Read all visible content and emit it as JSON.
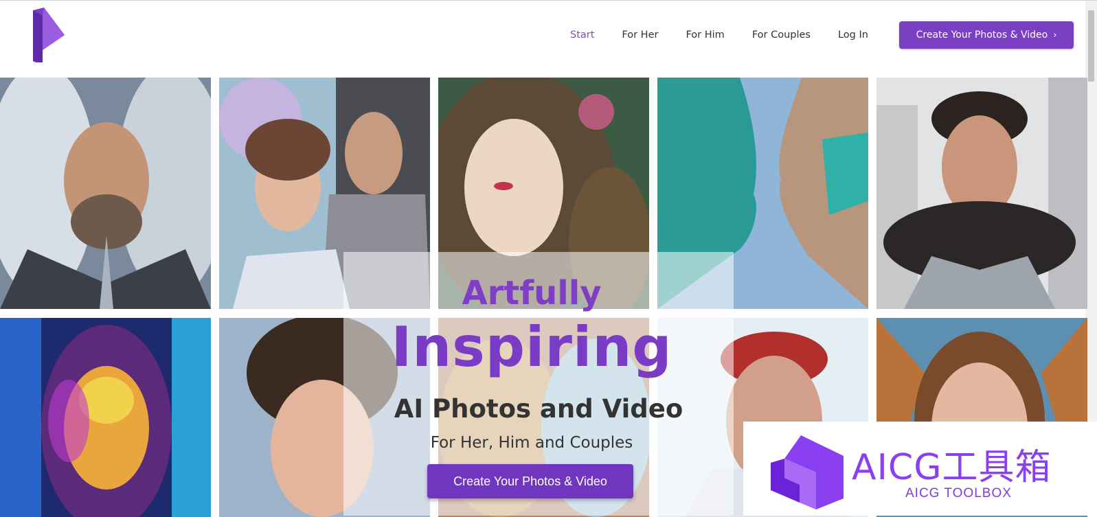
{
  "nav": {
    "items": [
      {
        "label": "Start",
        "active": true
      },
      {
        "label": "For Her",
        "active": false
      },
      {
        "label": "For Him",
        "active": false
      },
      {
        "label": "For Couples",
        "active": false
      },
      {
        "label": "Log In",
        "active": false
      }
    ],
    "cta_label": "Create Your Photos & Video",
    "cta_icon": "chevron-right-icon"
  },
  "hero": {
    "line1": "Artfully",
    "line2": "Inspiring",
    "line3": "AI Photos and Video",
    "line4": "For Her, Him and Couples",
    "button_label": "Create Your Photos & Video"
  },
  "watermark": {
    "title": "AICG工具箱",
    "subtitle": "AICG TOOLBOX"
  },
  "colors": {
    "brand_purple": "#7b3fc4",
    "nav_active": "#7e4cc4",
    "text_dark": "#333333"
  }
}
